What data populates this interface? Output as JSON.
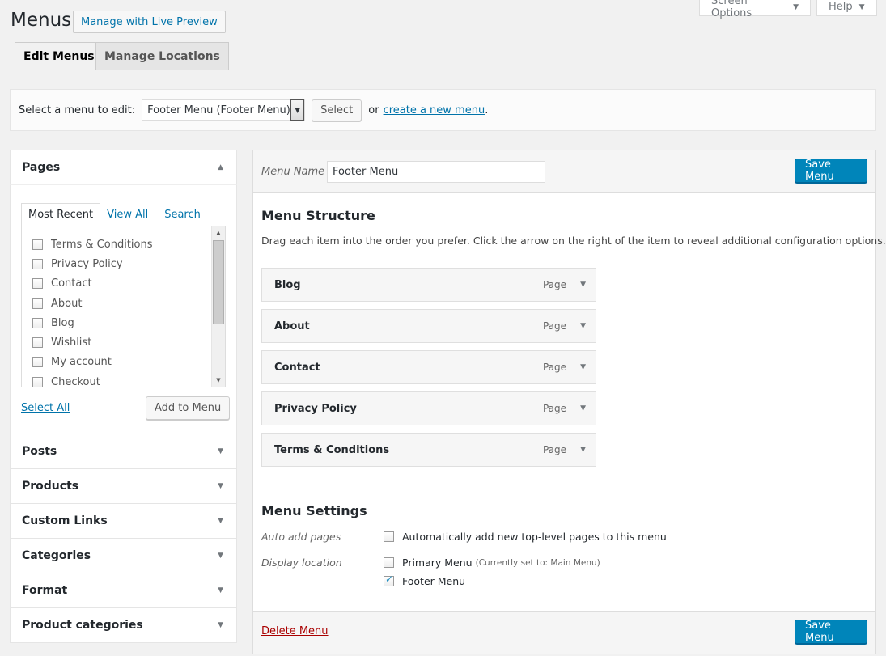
{
  "screen_options": "Screen Options",
  "help": "Help",
  "page_title": "Menus",
  "live_preview": "Manage with Live Preview",
  "tabs": [
    "Edit Menus",
    "Manage Locations"
  ],
  "manage": {
    "label": "Select a menu to edit:",
    "selected_menu": "Footer Menu (Footer Menu)",
    "select_button": "Select",
    "or": "or",
    "create_link": "create a new menu",
    "period": "."
  },
  "pages_box": {
    "title": "Pages",
    "subtabs": [
      "Most Recent",
      "View All",
      "Search"
    ],
    "items": [
      "Terms & Conditions",
      "Privacy Policy",
      "Contact",
      "About",
      "Blog",
      "Wishlist",
      "My account",
      "Checkout"
    ],
    "select_all": "Select All",
    "add_to_menu": "Add to Menu"
  },
  "sections": [
    "Posts",
    "Products",
    "Custom Links",
    "Categories",
    "Format",
    "Product categories"
  ],
  "menu_edit": {
    "menu_name_label": "Menu Name",
    "menu_name_value": "Footer Menu",
    "save": "Save Menu",
    "structure_title": "Menu Structure",
    "structure_desc": "Drag each item into the order you prefer. Click the arrow on the right of the item to reveal additional configuration options.",
    "items": [
      {
        "label": "Blog",
        "type": "Page"
      },
      {
        "label": "About",
        "type": "Page"
      },
      {
        "label": "Contact",
        "type": "Page"
      },
      {
        "label": "Privacy Policy",
        "type": "Page"
      },
      {
        "label": "Terms & Conditions",
        "type": "Page"
      }
    ],
    "settings_title": "Menu Settings",
    "auto_add_label": "Auto add pages",
    "auto_add_text": "Automatically add new top-level pages to this menu",
    "display_location_label": "Display location",
    "primary_menu": "Primary Menu",
    "primary_note": "(Currently set to: Main Menu)",
    "footer_menu": "Footer Menu",
    "delete": "Delete Menu"
  }
}
